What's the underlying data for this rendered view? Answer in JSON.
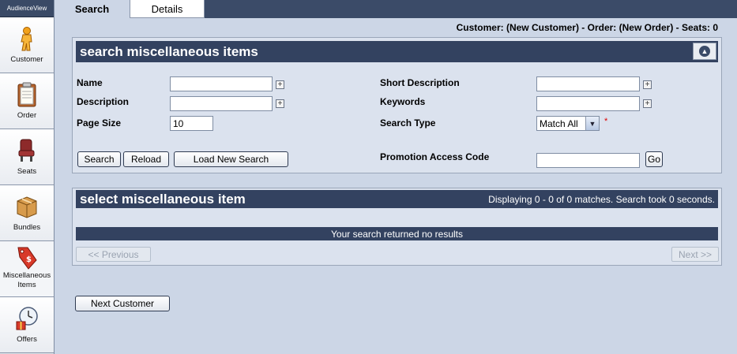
{
  "app": {
    "brand": "AudienceView"
  },
  "sidebar": {
    "items": [
      {
        "label": "Customer",
        "icon": "customer-figure-icon"
      },
      {
        "label": "Order",
        "icon": "clipboard-icon"
      },
      {
        "label": "Seats",
        "icon": "seat-icon"
      },
      {
        "label": "Bundles",
        "icon": "box-icon"
      },
      {
        "label": "Miscellaneous Items",
        "icon": "price-tag-icon"
      },
      {
        "label": "Offers",
        "icon": "clock-gift-icon"
      }
    ]
  },
  "tabs": [
    {
      "label": "Search",
      "active": true
    },
    {
      "label": "Details",
      "active": false
    }
  ],
  "info": {
    "status_line": "Customer: (New Customer) - Order: (New Order) - Seats: 0"
  },
  "search_panel": {
    "title": "search miscellaneous items",
    "fields": {
      "name_label": "Name",
      "name_value": "",
      "description_label": "Description",
      "description_value": "",
      "page_size_label": "Page Size",
      "page_size_value": "10",
      "short_description_label": "Short Description",
      "short_description_value": "",
      "keywords_label": "Keywords",
      "keywords_value": "",
      "search_type_label": "Search Type",
      "search_type_value": "Match All",
      "required_marker": "*",
      "promo_label": "Promotion Access Code",
      "promo_value": ""
    },
    "buttons": {
      "search": "Search",
      "reload": "Reload",
      "load_new_search": "Load New Search",
      "go": "Go"
    }
  },
  "results_panel": {
    "title": "select miscellaneous item",
    "status": "Displaying 0 - 0 of 0 matches. Search took 0 seconds.",
    "no_results": "Your search returned no results",
    "previous": "<< Previous",
    "next": "Next >>"
  },
  "footer": {
    "next_customer": "Next Customer"
  },
  "colors": {
    "header_bg": "#334260",
    "page_bg": "#ccd6e6",
    "panel_bg": "#dbe2ee",
    "required": "#dd0000"
  }
}
